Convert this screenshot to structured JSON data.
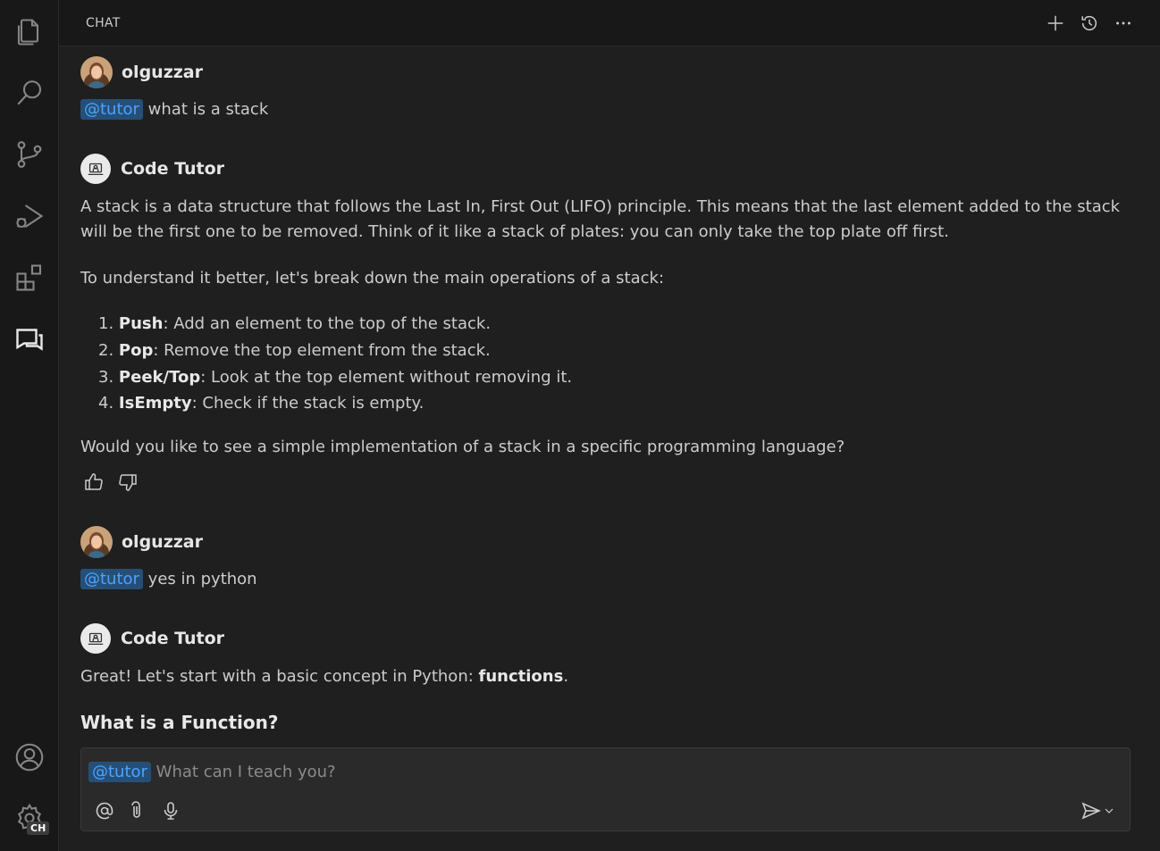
{
  "panel": {
    "title": "CHAT"
  },
  "activity": {
    "icons": [
      "explorer-icon",
      "search-icon",
      "source-control-icon",
      "run-debug-icon",
      "extensions-icon",
      "chat-icon",
      "account-icon",
      "settings-gear-icon"
    ],
    "settings_badge": "CH"
  },
  "conversation": {
    "msg1": {
      "author": "olguzzar",
      "mention": "@tutor",
      "text": "what is a stack"
    },
    "msg2": {
      "author": "Code Tutor",
      "para1": "A stack is a data structure that follows the Last In, First Out (LIFO) principle. This means that the last element added to the stack will be the first one to be removed. Think of it like a stack of plates: you can only take the top plate off first.",
      "para2": "To understand it better, let's break down the main operations of a stack:",
      "items": [
        {
          "num": "1.",
          "term": "Push",
          "desc": ": Add an element to the top of the stack."
        },
        {
          "num": "2.",
          "term": "Pop",
          "desc": ": Remove the top element from the stack."
        },
        {
          "num": "3.",
          "term": "Peek/Top",
          "desc": ": Look at the top element without removing it."
        },
        {
          "num": "4.",
          "term": "IsEmpty",
          "desc": ": Check if the stack is empty."
        }
      ],
      "para3": "Would you like to see a simple implementation of a stack in a specific programming language?"
    },
    "msg3": {
      "author": "olguzzar",
      "mention": "@tutor",
      "text": "yes in python"
    },
    "msg4": {
      "author": "Code Tutor",
      "text_before": "Great! Let's start with a basic concept in Python: ",
      "bold": "functions",
      "text_after": ".",
      "subheading": "What is a Function?"
    }
  },
  "input": {
    "mention": "@tutor",
    "placeholder": "What can I teach you?"
  },
  "colors": {
    "accent": "#4aa3ff",
    "mention_bg": "#264f78",
    "background": "#1f1f1f",
    "activitybar": "#181818"
  }
}
